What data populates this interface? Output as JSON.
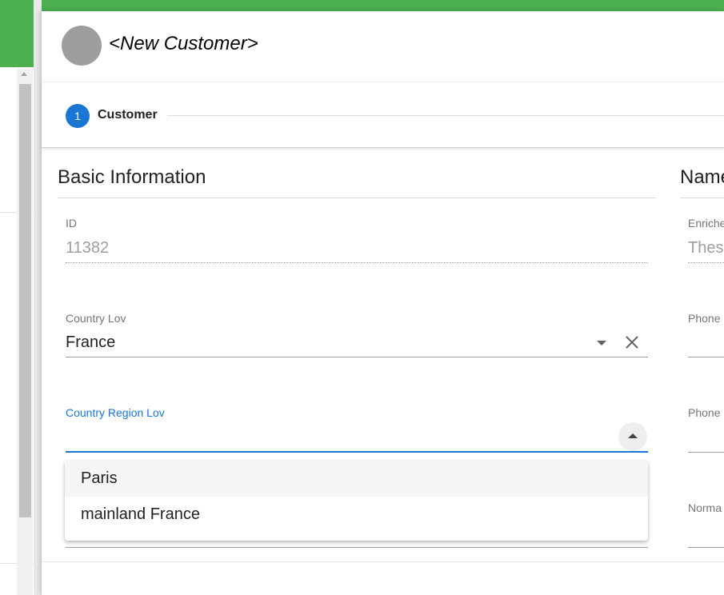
{
  "dialog": {
    "title": "<New Customer>"
  },
  "stepper": {
    "steps": [
      {
        "number": "1",
        "label": "Customer"
      }
    ]
  },
  "basic_info": {
    "title": "Basic Information",
    "id_field": {
      "label": "ID",
      "value": "11382"
    },
    "country_field": {
      "label": "Country Lov",
      "value": "France"
    },
    "region_field": {
      "label": "Country Region Lov",
      "value": "",
      "options": [
        "Paris",
        "mainland France"
      ]
    }
  },
  "names_section": {
    "title": "Name",
    "fields": [
      {
        "label": "Enriche",
        "value": "Thes"
      },
      {
        "label": "Phone",
        "value": ""
      },
      {
        "label": "Phone",
        "value": ""
      },
      {
        "label": "Norma",
        "value": ""
      }
    ]
  },
  "colors": {
    "accent": "#1976d2",
    "topbar": "#4caf50"
  }
}
